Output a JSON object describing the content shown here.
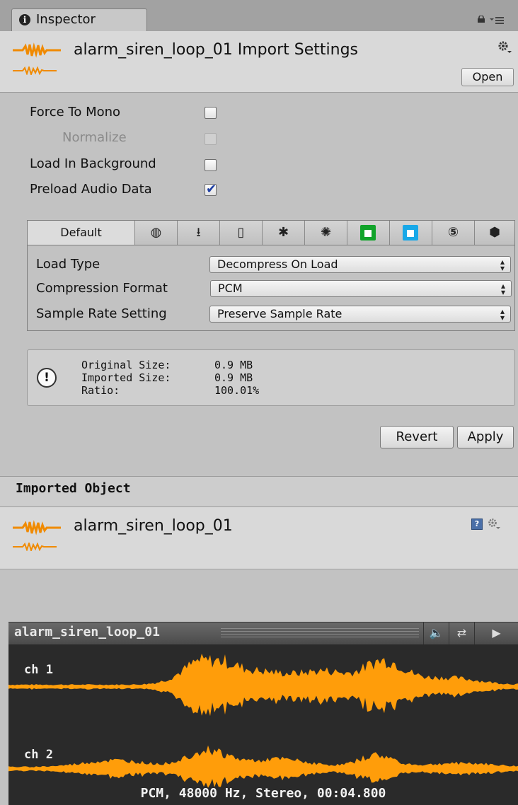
{
  "tab": {
    "label": "Inspector"
  },
  "header": {
    "title": "alarm_siren_loop_01 Import Settings",
    "open_label": "Open"
  },
  "options": [
    {
      "label": "Force To Mono",
      "checked": false,
      "disabled": false
    },
    {
      "label": "Normalize",
      "checked": false,
      "disabled": true
    },
    {
      "label": "Load In Background",
      "checked": false,
      "disabled": false
    },
    {
      "label": "Preload Audio Data",
      "checked": true,
      "disabled": false
    }
  ],
  "platforms": {
    "default_label": "Default",
    "icons": [
      "globe-icon",
      "download-icon",
      "phone-icon",
      "android-icon",
      "tizen-icon",
      "windows-store-green-icon",
      "windows-store-blue-icon",
      "html5-icon",
      "package-icon"
    ]
  },
  "settings": [
    {
      "label": "Load Type",
      "value": "Decompress On Load"
    },
    {
      "label": "Compression Format",
      "value": "PCM"
    },
    {
      "label": "Sample Rate Setting",
      "value": "Preserve Sample Rate"
    }
  ],
  "info": {
    "rows": [
      {
        "label": "Original Size:",
        "value": "0.9 MB"
      },
      {
        "label": "Imported Size:",
        "value": "0.9 MB"
      },
      {
        "label": "Ratio:",
        "value": "100.01%"
      }
    ]
  },
  "actions": {
    "revert": "Revert",
    "apply": "Apply"
  },
  "imported": {
    "section_title": "Imported Object",
    "name": "alarm_siren_loop_01"
  },
  "preview": {
    "title": "alarm_siren_loop_01",
    "channels": [
      "ch 1",
      "ch 2"
    ],
    "info": "PCM, 48000 Hz, Stereo, 00:04.800",
    "wave_color": "#ff9d0a"
  }
}
